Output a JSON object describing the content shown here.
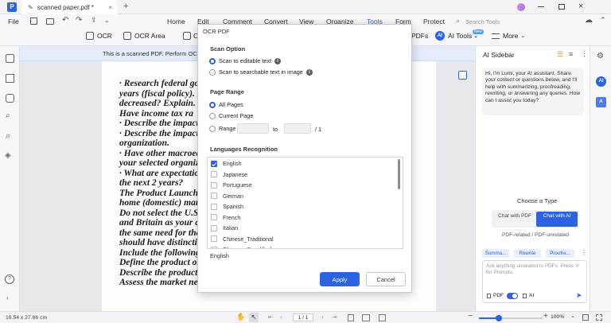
{
  "titlebar": {
    "tab_title": "scanned paper.pdf *",
    "file_label": "File",
    "search_placeholder": "Search Tools"
  },
  "menu": [
    {
      "label": "Home",
      "active": false
    },
    {
      "label": "Edit",
      "active": false
    },
    {
      "label": "Comment",
      "active": false
    },
    {
      "label": "Convert",
      "active": false
    },
    {
      "label": "View",
      "active": false
    },
    {
      "label": "Organize",
      "active": false
    },
    {
      "label": "Tools",
      "active": true
    },
    {
      "label": "Form",
      "active": false
    },
    {
      "label": "Protect",
      "active": false
    }
  ],
  "toolbar": {
    "ocr": "OCR",
    "ocr_area": "OCR Area",
    "c": "C",
    "pdfs": "PDFs",
    "ai_tools": "AI Tools",
    "new_badge": "New",
    "more": "More"
  },
  "banner": {
    "text": "This is a scanned PDF. Perform OCR to "
  },
  "document": {
    "lines": [
      "· Research federal go",
      "years (fiscal policy). I",
      "decreased? Explain.",
      "   Have income tax ra",
      "· Describe the impact",
      "· Describe the impact",
      "organization.",
      "· Have other macroec",
      "your selected organiz",
      "· What are expectatio",
      "the next 2 years?",
      "",
      "The Product Launch",
      "home (domestic) mar",
      "Do not select the U.S.",
      "and Britain as your c",
      "the same need for the",
      "should have distinctiv",
      "Include the following",
      "Define the product or",
      "Describe the product",
      "Assess the market needs for this product or service."
    ]
  },
  "dialog": {
    "title": "OCR PDF",
    "scan_option_label": "Scan Option",
    "scan_editable": "Scan to editable text",
    "scan_searchable": "Scan to searchable text in image",
    "page_range_label": "Page Range",
    "all_pages": "All Pages",
    "current_page": "Current Page",
    "range": "Range",
    "range_to": "to",
    "range_total": "/ 1",
    "languages_label": "Languages Recognition",
    "languages": [
      {
        "name": "English",
        "checked": true
      },
      {
        "name": "Japanese",
        "checked": false
      },
      {
        "name": "Portuguese",
        "checked": false
      },
      {
        "name": "German",
        "checked": false
      },
      {
        "name": "Spanish",
        "checked": false
      },
      {
        "name": "French",
        "checked": false
      },
      {
        "name": "Italian",
        "checked": false
      },
      {
        "name": "Chinese_Traditional",
        "checked": false
      },
      {
        "name": "Chinese_Simplified",
        "checked": false
      }
    ],
    "selected_summary": "English",
    "apply": "Apply",
    "cancel": "Cancel"
  },
  "sidebar": {
    "title": "AI Sidebar",
    "greeting": "Hi, I'm Lumi, your AI assistant. Share your content or questions below, and I'll help with summarizing, proofreading, rewriting, or answering any queries. How can I assist you today?",
    "choose_type": "Choose a Type",
    "chat_pdf": "Chat with PDF",
    "chat_ai": "Chat with AI",
    "mode_caption": "PDF-related / PDF-unrelated",
    "chips": [
      "Summa...",
      "Rewrite",
      "Proofre..."
    ],
    "input_placeholder": "Ask anything unrelated to PDFs. Press '#' for Prompts.",
    "pdf_label": "PDF",
    "ai_label": "AI"
  },
  "status": {
    "dimensions": "19.54 x 27.66 cm",
    "page": "1 / 1",
    "zoom": "100%"
  },
  "colors": {
    "accent": "#2b63e3",
    "banner": "#e4ebfb",
    "chip": "#e6eeff"
  }
}
